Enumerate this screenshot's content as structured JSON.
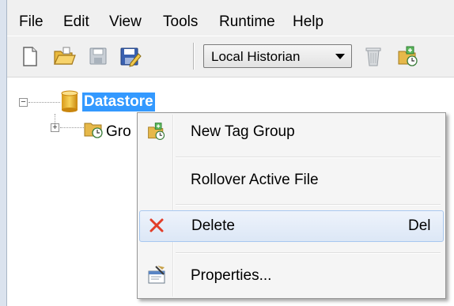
{
  "menubar": {
    "items": [
      "File",
      "Edit",
      "View",
      "Tools",
      "Runtime",
      "Help"
    ]
  },
  "toolbar": {
    "buttons": [
      "new-icon",
      "open-icon",
      "save-icon",
      "save-as-icon",
      "trash-icon",
      "tag-group-icon"
    ],
    "historian_select_value": "Local Historian"
  },
  "tree": {
    "root_label": "Datastore",
    "child_label": "Gro"
  },
  "context_menu": {
    "items": [
      {
        "label": "New Tag Group",
        "icon": "tag-group-icon",
        "shortcut": ""
      },
      {
        "label": "Rollover Active File",
        "icon": "",
        "shortcut": ""
      },
      {
        "label": "Delete",
        "icon": "delete-x-icon",
        "shortcut": "Del"
      },
      {
        "label": "Properties...",
        "icon": "properties-icon",
        "shortcut": ""
      }
    ]
  },
  "colors": {
    "selection": "#3399ff",
    "delete_icon": "#e23d28",
    "menu_hover_border": "#a8c8f0"
  }
}
